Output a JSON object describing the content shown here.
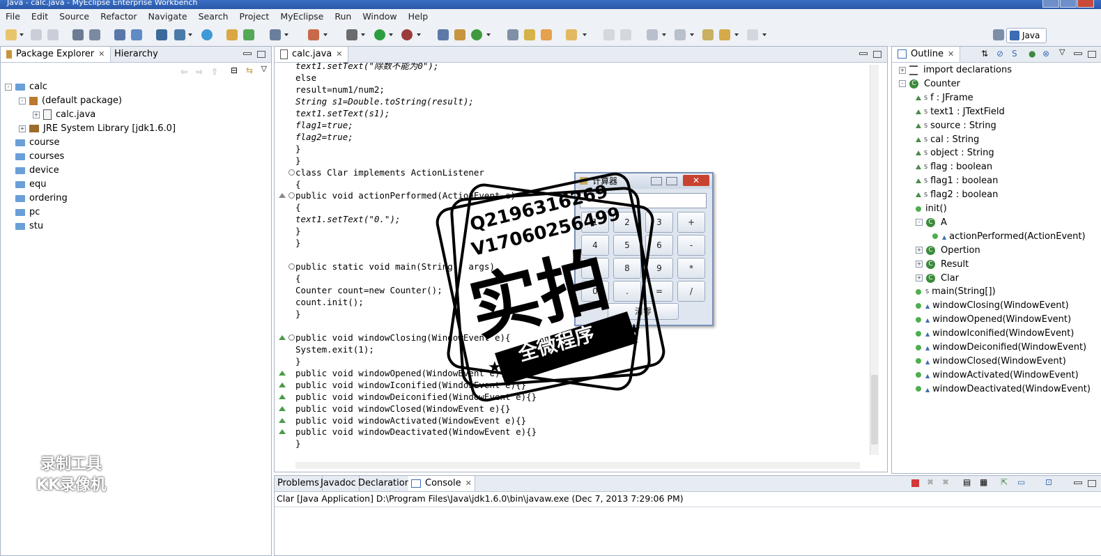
{
  "window": {
    "title": "Java - calc.java - MyEclipse Enterprise Workbench"
  },
  "menu": [
    "File",
    "Edit",
    "Source",
    "Refactor",
    "Navigate",
    "Search",
    "Project",
    "MyEclipse",
    "Run",
    "Window",
    "Help"
  ],
  "perspective": {
    "label": "Java"
  },
  "package_explorer": {
    "tabs": [
      "Package Explorer",
      "Hierarchy"
    ],
    "tree": [
      {
        "label": "calc",
        "depth": 0,
        "icon": "project-icon",
        "expander": "-"
      },
      {
        "label": "(default package)",
        "depth": 1,
        "icon": "package-icon",
        "expander": "-"
      },
      {
        "label": "calc.java",
        "depth": 2,
        "icon": "java-file-icon",
        "expander": "+"
      },
      {
        "label": "JRE System Library [jdk1.6.0]",
        "depth": 1,
        "icon": "jar-icon",
        "expander": "+"
      },
      {
        "label": "course",
        "depth": 0,
        "icon": "folder-icon"
      },
      {
        "label": "courses",
        "depth": 0,
        "icon": "folder-icon"
      },
      {
        "label": "device",
        "depth": 0,
        "icon": "folder-icon"
      },
      {
        "label": "equ",
        "depth": 0,
        "icon": "folder-icon"
      },
      {
        "label": "ordering",
        "depth": 0,
        "icon": "folder-icon"
      },
      {
        "label": "pc",
        "depth": 0,
        "icon": "folder-icon"
      },
      {
        "label": "stu",
        "depth": 0,
        "icon": "folder-icon"
      }
    ]
  },
  "editor": {
    "tab": "calc.java",
    "lines": [
      {
        "text": "text1.setText(\"除数不能为0\");",
        "indent": 0
      },
      {
        "text": "else",
        "indent": 0
      },
      {
        "text": "result=num1/num2;",
        "indent": 0
      },
      {
        "text": "String s1=Double.toString(result);",
        "indent": 0
      },
      {
        "text": "text1.setText(s1);",
        "indent": 0
      },
      {
        "text": "flag1=true;",
        "indent": 0
      },
      {
        "text": "flag2=true;",
        "indent": 0
      },
      {
        "text": "}",
        "indent": 0
      },
      {
        "text": "}",
        "indent": 0
      },
      {
        "text": "class Clar implements ActionListener",
        "indent": 0,
        "fold": true
      },
      {
        "text": "{",
        "indent": 0
      },
      {
        "text": "public void actionPerformed(ActionEvent e)",
        "indent": 0,
        "fold": true,
        "mark": "override-triangle"
      },
      {
        "text": "{",
        "indent": 0
      },
      {
        "text": "text1.setText(\"0.\");",
        "indent": 0
      },
      {
        "text": "}",
        "indent": 0
      },
      {
        "text": "}",
        "indent": 0
      },
      {
        "text": "",
        "indent": 0
      },
      {
        "text": "public static void main(String[] args)",
        "indent": 0,
        "fold": true
      },
      {
        "text": "{",
        "indent": 0
      },
      {
        "text": "Counter count=new Counter();",
        "indent": 0
      },
      {
        "text": "count.init();",
        "indent": 0
      },
      {
        "text": "}",
        "indent": 0
      },
      {
        "text": "",
        "indent": 0
      },
      {
        "text": "public void windowClosing(WindowEvent e){",
        "indent": 0,
        "fold": true,
        "mark": "implement-triangle"
      },
      {
        "text": "System.exit(1);",
        "indent": 0
      },
      {
        "text": "}",
        "indent": 0
      },
      {
        "text": "public void windowOpened(WindowEvent e){}",
        "indent": 0,
        "mark": "implement-triangle"
      },
      {
        "text": "public void windowIconified(WindowEvent e){}",
        "indent": 0,
        "mark": "implement-triangle"
      },
      {
        "text": "public void windowDeiconified(WindowEvent e){}",
        "indent": 0,
        "mark": "implement-triangle"
      },
      {
        "text": "public void windowClosed(WindowEvent e){}",
        "indent": 0,
        "mark": "implement-triangle"
      },
      {
        "text": "public void windowActivated(WindowEvent e){}",
        "indent": 0,
        "mark": "implement-triangle"
      },
      {
        "text": "public void windowDeactivated(WindowEvent e){}",
        "indent": 0,
        "mark": "implement-triangle"
      },
      {
        "text": "}",
        "indent": 0
      }
    ]
  },
  "outline": {
    "tab": "Outline",
    "items": [
      {
        "label": "import declarations",
        "depth": 0,
        "kind": "imports",
        "expander": "+"
      },
      {
        "label": "Counter",
        "depth": 0,
        "kind": "class",
        "expander": "-"
      },
      {
        "label": "f : JFrame",
        "depth": 1,
        "kind": "field-static"
      },
      {
        "label": "text1 : JTextField",
        "depth": 1,
        "kind": "field-static"
      },
      {
        "label": "source : String",
        "depth": 1,
        "kind": "field-static"
      },
      {
        "label": "cal : String",
        "depth": 1,
        "kind": "field-static"
      },
      {
        "label": "object : String",
        "depth": 1,
        "kind": "field-static"
      },
      {
        "label": "flag : boolean",
        "depth": 1,
        "kind": "field-static"
      },
      {
        "label": "flag1 : boolean",
        "depth": 1,
        "kind": "field-static"
      },
      {
        "label": "flag2 : boolean",
        "depth": 1,
        "kind": "field-static"
      },
      {
        "label": "init()",
        "depth": 1,
        "kind": "method"
      },
      {
        "label": "A",
        "depth": 1,
        "kind": "class",
        "expander": "-"
      },
      {
        "label": "actionPerformed(ActionEvent)",
        "depth": 2,
        "kind": "method-override"
      },
      {
        "label": "Opertion",
        "depth": 1,
        "kind": "class",
        "expander": "+"
      },
      {
        "label": "Result",
        "depth": 1,
        "kind": "class",
        "expander": "+"
      },
      {
        "label": "Clar",
        "depth": 1,
        "kind": "class",
        "expander": "+"
      },
      {
        "label": "main(String[])",
        "depth": 1,
        "kind": "method-static"
      },
      {
        "label": "windowClosing(WindowEvent)",
        "depth": 1,
        "kind": "method-impl"
      },
      {
        "label": "windowOpened(WindowEvent)",
        "depth": 1,
        "kind": "method-impl"
      },
      {
        "label": "windowIconified(WindowEvent)",
        "depth": 1,
        "kind": "method-impl"
      },
      {
        "label": "windowDeiconified(WindowEvent)",
        "depth": 1,
        "kind": "method-impl"
      },
      {
        "label": "windowClosed(WindowEvent)",
        "depth": 1,
        "kind": "method-impl"
      },
      {
        "label": "windowActivated(WindowEvent)",
        "depth": 1,
        "kind": "method-impl"
      },
      {
        "label": "windowDeactivated(WindowEvent)",
        "depth": 1,
        "kind": "method-impl"
      }
    ]
  },
  "console": {
    "tabs": [
      "Problems",
      "Javadoc",
      "Declaration",
      "Console"
    ],
    "status": "Clar [Java Application] D:\\Program Files\\Java\\jdk1.6.0\\bin\\javaw.exe (Dec 7, 2013 7:29:06 PM)"
  },
  "calculator": {
    "title": "计算器",
    "buttons": [
      "1",
      "2",
      "3",
      "+",
      "4",
      "5",
      "6",
      "-",
      "7",
      "8",
      "9",
      "*",
      "0",
      ".",
      "=",
      "/"
    ],
    "clear_label": "清零"
  },
  "watermarks": {
    "recorder_line1": "录制工具",
    "recorder_line2": "KK录像机",
    "stamp_contact1": "Q2196316269",
    "stamp_contact2": "V17060256499",
    "stamp_big": "实拍",
    "stamp_banner": "全微程序"
  },
  "colors": {
    "titlebar": "#2a58a8",
    "chrome": "#eef1f6",
    "green_marker": "#4a9b4a",
    "folder": "#6a9fd8"
  }
}
